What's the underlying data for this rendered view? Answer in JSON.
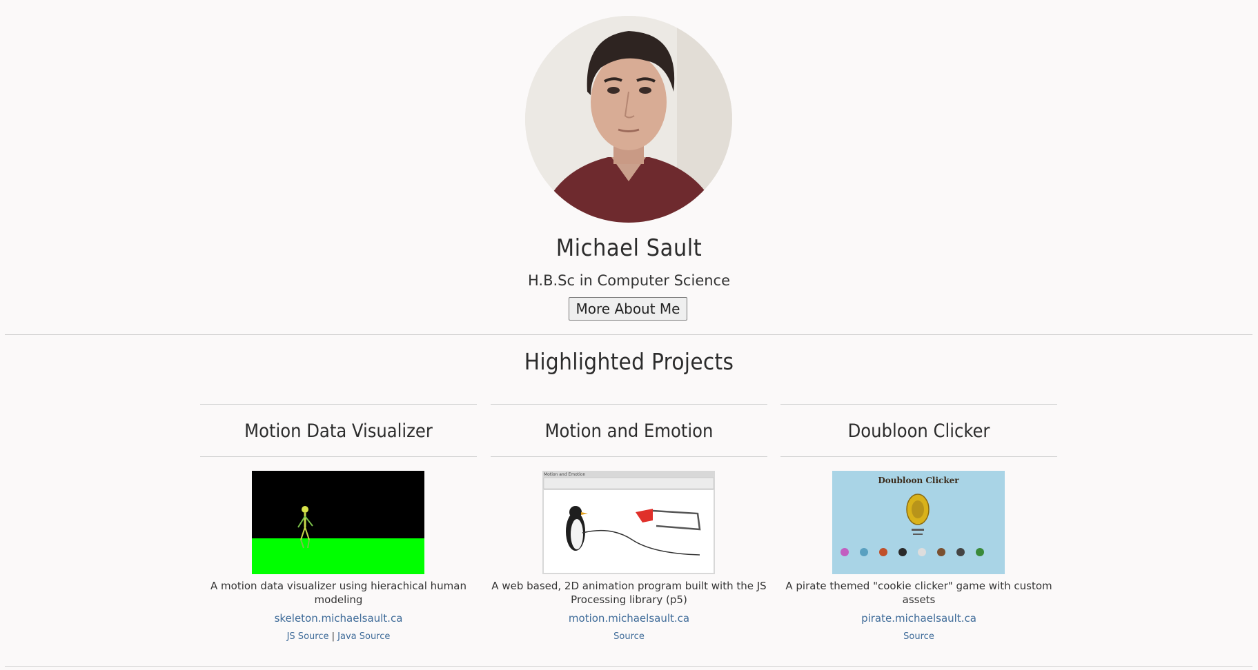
{
  "profile": {
    "name": "Michael Sault",
    "degree": "H.B.Sc in Computer Science",
    "about_button": "More About Me"
  },
  "projects_section": {
    "title": "Highlighted Projects",
    "projects": [
      {
        "title": "Motion Data Visualizer",
        "description": "A motion data visualizer using hierachical human modeling",
        "link": "skeleton.michaelsault.ca",
        "sources": [
          "JS Source",
          "Java Source"
        ]
      },
      {
        "title": "Motion and Emotion",
        "description": "A web based, 2D animation program built with the JS Processing library (p5)",
        "link": "motion.michaelsault.ca",
        "sources": [
          "Source"
        ],
        "thumb_caption": "Motion and Emotion"
      },
      {
        "title": "Doubloon Clicker",
        "description": "A pirate themed \"cookie clicker\" game with custom assets",
        "link": "pirate.michaelsault.ca",
        "sources": [
          "Source"
        ],
        "thumb_caption": "Doubloon Clicker"
      }
    ]
  },
  "colors": {
    "background": "#fbf9f9",
    "link": "#3d6a98",
    "divider": "#cfcfcf",
    "heading": "#2c2c2c"
  }
}
